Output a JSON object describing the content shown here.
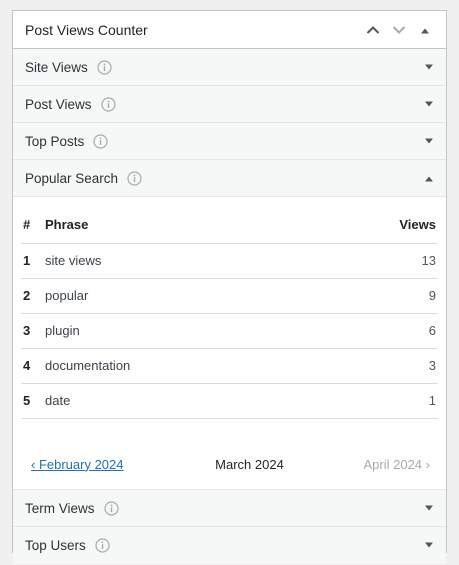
{
  "widget": {
    "title": "Post Views Counter",
    "controls": [
      "chevron-up-icon",
      "chevron-down-icon",
      "collapse-triangle-icon"
    ]
  },
  "sections": [
    {
      "label": "Site Views",
      "expanded": false
    },
    {
      "label": "Post Views",
      "expanded": false
    },
    {
      "label": "Top Posts",
      "expanded": false
    },
    {
      "label": "Popular Search",
      "expanded": true
    },
    {
      "label": "Term Views",
      "expanded": false
    },
    {
      "label": "Top Users",
      "expanded": false
    }
  ],
  "popular_search": {
    "columns": {
      "rank": "#",
      "phrase": "Phrase",
      "views": "Views"
    },
    "rows": [
      {
        "rank": "1",
        "phrase": "site views",
        "views": "13"
      },
      {
        "rank": "2",
        "phrase": "popular",
        "views": "9"
      },
      {
        "rank": "3",
        "phrase": "plugin",
        "views": "6"
      },
      {
        "rank": "4",
        "phrase": "documentation",
        "views": "3"
      },
      {
        "rank": "5",
        "phrase": "date",
        "views": "1"
      }
    ],
    "pager": {
      "prev": "‹ February 2024",
      "current": "March 2024",
      "next": "April 2024 ›"
    }
  },
  "colors": {
    "link": "#2271b1",
    "disabled": "#a7aaad",
    "border": "#c3c4c7",
    "section_bg": "#f6f7f7"
  }
}
